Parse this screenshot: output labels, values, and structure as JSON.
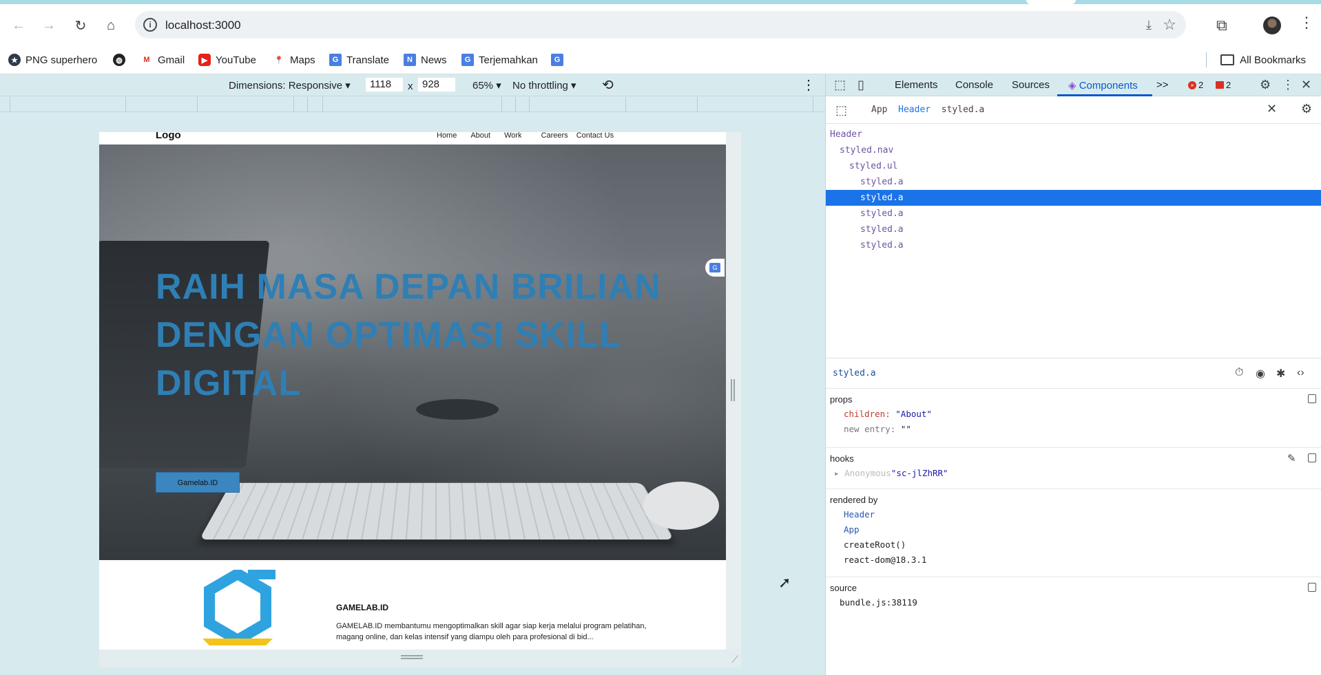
{
  "browser": {
    "url": "localhost:3000",
    "bookmarks": [
      "PNG superhero",
      "",
      "Gmail",
      "YouTube",
      "Maps",
      "Translate",
      "News",
      "Terjemahkan",
      ""
    ],
    "all_bookmarks": "All Bookmarks"
  },
  "device_toolbar": {
    "dimensions_label": "Dimensions: Responsive ▾",
    "width": "1118",
    "times": "x",
    "height": "928",
    "zoom": "65% ▾",
    "throttling": "No throttling ▾"
  },
  "page": {
    "logo": "Logo",
    "nav": [
      "Home",
      "About",
      "Work",
      "Careers",
      "Contact Us"
    ],
    "hero_title": "RAIH MASA DEPAN BRILIAN DENGAN OPTIMASI SKILL DIGITAL",
    "hero_button": "Gamelab.ID",
    "about_title": "GAMELAB.ID",
    "about_text": "GAMELAB.ID membantumu mengoptimalkan skill agar siap kerja melalui program pelatihan, magang online, dan kelas intensif yang diampu oleh para profesional di bid..."
  },
  "devtools": {
    "tabs": [
      "Elements",
      "Console",
      "Sources",
      "Components"
    ],
    "active_tab": "Components",
    "more": ">>",
    "errors": "2",
    "issues": "2",
    "breadcrumbs": {
      "a": "App",
      "b": "Header",
      "c": "styled.a"
    },
    "tree": [
      {
        "label": "Header",
        "depth": 0
      },
      {
        "label": "styled.nav",
        "depth": 1
      },
      {
        "label": "styled.ul",
        "depth": 2
      },
      {
        "label": "styled.a",
        "depth": 3
      },
      {
        "label": "styled.a",
        "depth": 3,
        "selected": true
      },
      {
        "label": "styled.a",
        "depth": 3
      },
      {
        "label": "styled.a",
        "depth": 3
      },
      {
        "label": "styled.a",
        "depth": 3
      }
    ],
    "inspector": {
      "selected_name": "styled.a",
      "props_title": "props",
      "children_key": "children:",
      "children_val": "\"About\"",
      "new_entry_key": "new entry:",
      "new_entry_val": "\"\"",
      "hooks_title": "hooks",
      "hook_name": "Anonymous",
      "hook_val": "\"sc-jlZhRR\"",
      "rendered_by_title": "rendered by",
      "rendered_by": [
        "Header",
        "App",
        "createRoot()",
        "react-dom@18.3.1"
      ],
      "source_title": "source",
      "source": "bundle.js:38119"
    }
  }
}
